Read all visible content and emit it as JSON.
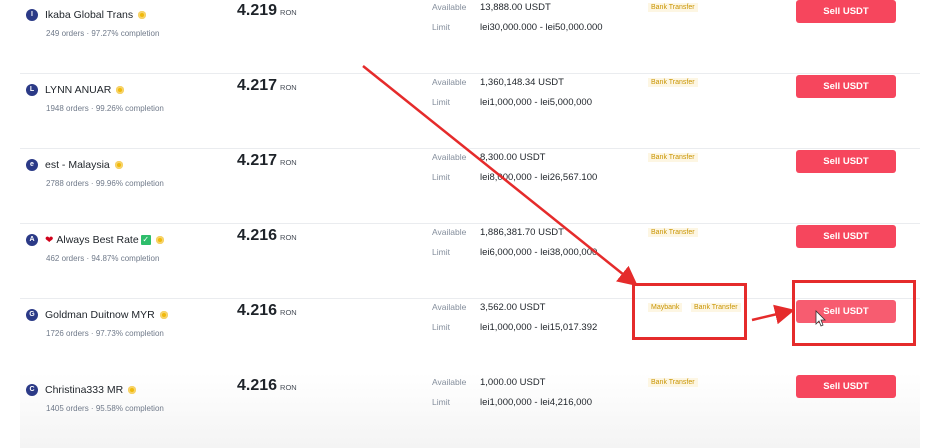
{
  "labels": {
    "available": "Available",
    "limit": "Limit"
  },
  "offers": [
    {
      "avatar": "I",
      "name": "Ikaba Global Trans",
      "orders": "249 orders",
      "completion": "97.27% completion",
      "price": "4.219",
      "currency": "RON",
      "available": "13,888.00 USDT",
      "limit": "lei30,000.000 - lei50,000.000",
      "payments": [
        "Bank Transfer"
      ],
      "action": "Sell USDT"
    },
    {
      "avatar": "L",
      "name": "LYNN ANUAR",
      "orders": "1948 orders",
      "completion": "99.26% completion",
      "price": "4.217",
      "currency": "RON",
      "available": "1,360,148.34 USDT",
      "limit": "lei1,000,000 - lei5,000,000",
      "payments": [
        "Bank Transfer"
      ],
      "action": "Sell USDT"
    },
    {
      "avatar": "e",
      "name": "est - Malaysia",
      "orders": "2788 orders",
      "completion": "99.96% completion",
      "price": "4.217",
      "currency": "RON",
      "available": "8,300.00 USDT",
      "limit": "lei8,000,000 - lei26,567.100",
      "payments": [
        "Bank Transfer"
      ],
      "action": "Sell USDT"
    },
    {
      "avatar": "A",
      "name": "Always Best Rate",
      "orders": "462 orders",
      "completion": "94.87% completion",
      "price": "4.216",
      "currency": "RON",
      "available": "1,886,381.70 USDT",
      "limit": "lei6,000,000 - lei38,000,000",
      "payments": [
        "Bank Transfer"
      ],
      "action": "Sell USDT"
    },
    {
      "avatar": "G",
      "name": "Goldman Duitnow MYR",
      "orders": "1726 orders",
      "completion": "97.73% completion",
      "price": "4.216",
      "currency": "RON",
      "available": "3,562.00 USDT",
      "limit": "lei1,000,000 - lei15,017.392",
      "payments": [
        "Maybank",
        "Bank Transfer"
      ],
      "action": "Sell USDT"
    },
    {
      "avatar": "C",
      "name": "Christina333 MR",
      "orders": "1405 orders",
      "completion": "95.58% completion",
      "price": "4.216",
      "currency": "RON",
      "available": "1,000.00 USDT",
      "limit": "lei1,000,000 - lei4,216,000",
      "payments": [
        "Bank Transfer"
      ],
      "action": "Sell USDT"
    }
  ],
  "colors": {
    "sell": "#f6465d",
    "annotation": "#e52b2b",
    "avatar": "#2b3a87",
    "verified": "#f0b90b"
  }
}
